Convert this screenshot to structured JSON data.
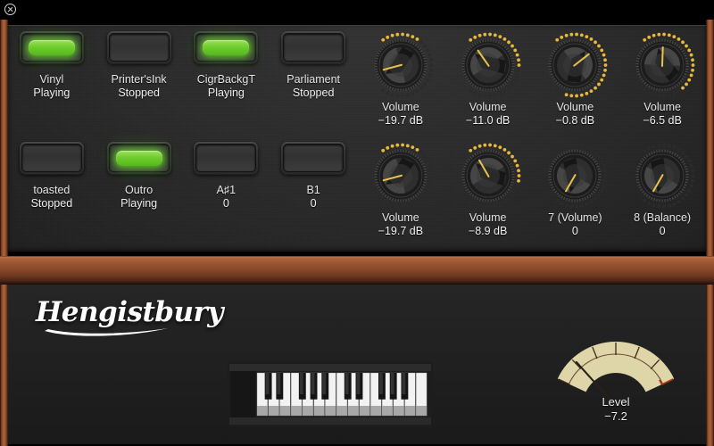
{
  "window": {
    "close_icon": "close-icon"
  },
  "theme": {
    "led_green": "#6fcc2e",
    "knob_led": "#e8b83a",
    "wood": "#9d5733",
    "panel": "#2a2a2a",
    "meter_face": "#ded5a8",
    "text": "#e6e6e6"
  },
  "controls": {
    "row1": [
      {
        "type": "button",
        "name": "vinyl",
        "label": "Vinyl",
        "value": "Playing",
        "lit": true
      },
      {
        "type": "button",
        "name": "printersink",
        "label": "Printer'sInk",
        "value": "Stopped",
        "lit": false
      },
      {
        "type": "button",
        "name": "cigrbackgt",
        "label": "CigrBackgT",
        "value": "Playing",
        "lit": true
      },
      {
        "type": "button",
        "name": "parliament",
        "label": "Parliament",
        "value": "Stopped",
        "lit": false
      },
      {
        "type": "knob",
        "name": "volume-1",
        "label": "Volume",
        "value": "−19.7 dB",
        "angle": -105,
        "lit_fraction": 0.3
      },
      {
        "type": "knob",
        "name": "volume-2",
        "label": "Volume",
        "value": "−11.0 dB",
        "angle": -35,
        "lit_fraction": 0.52
      },
      {
        "type": "knob",
        "name": "volume-3",
        "label": "Volume",
        "value": "−0.8 dB",
        "angle": 52,
        "lit_fraction": 0.92
      },
      {
        "type": "knob",
        "name": "volume-4",
        "label": "Volume",
        "value": "−6.5 dB",
        "angle": 2,
        "lit_fraction": 0.72
      }
    ],
    "row2": [
      {
        "type": "button",
        "name": "toasted",
        "label": "toasted",
        "value": "Stopped",
        "lit": false
      },
      {
        "type": "button",
        "name": "outro",
        "label": "Outro",
        "value": "Playing",
        "lit": true
      },
      {
        "type": "button",
        "name": "asharp1",
        "label": "A♯1",
        "value": "0",
        "lit": false
      },
      {
        "type": "button",
        "name": "b1",
        "label": "B1",
        "value": "0",
        "lit": false
      },
      {
        "type": "knob",
        "name": "volume-5",
        "label": "Volume",
        "value": "−19.7 dB",
        "angle": -105,
        "lit_fraction": 0.3
      },
      {
        "type": "knob",
        "name": "volume-6",
        "label": "Volume",
        "value": "−8.9 dB",
        "angle": -30,
        "lit_fraction": 0.56
      },
      {
        "type": "knob",
        "name": "cc7-volume",
        "label": "7 (Volume)",
        "value": "0",
        "angle": -150,
        "lit_fraction": 0.0
      },
      {
        "type": "knob",
        "name": "cc8-balance",
        "label": "8 (Balance)",
        "value": "0",
        "angle": -150,
        "lit_fraction": 0.0
      }
    ]
  },
  "brand": {
    "logo_text": "Hengistbury"
  },
  "meter": {
    "label": "Level",
    "value": "−7.2",
    "needle_angle": -42,
    "ticks": 7
  },
  "keyboard": {
    "white_keys": 15,
    "octaves": 2
  }
}
